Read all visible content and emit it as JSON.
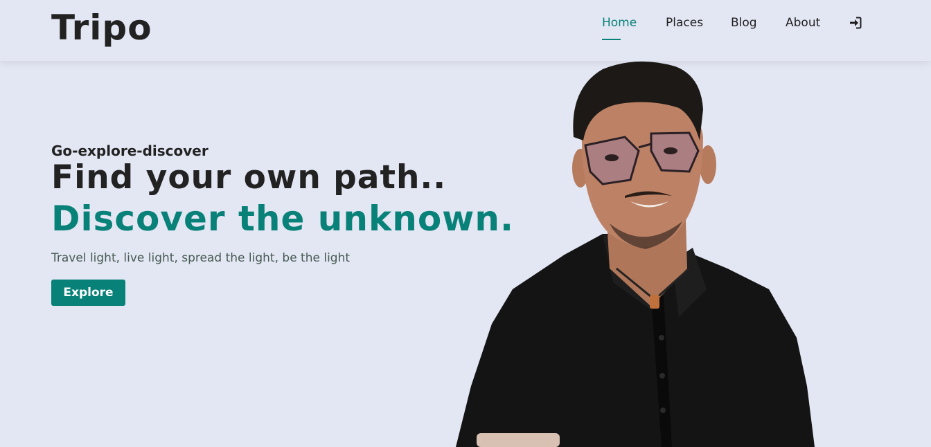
{
  "header": {
    "logo": "Tripo",
    "nav": [
      {
        "label": "Home",
        "active": true
      },
      {
        "label": "Places",
        "active": false
      },
      {
        "label": "Blog",
        "active": false
      },
      {
        "label": "About",
        "active": false
      }
    ],
    "login_icon": "sign-in-icon"
  },
  "hero": {
    "tagline": "Go-explore-discover",
    "headline1": "Find your own path..",
    "headline2": "Discover the unknown.",
    "subtext": "Travel light, live light, spread the light, be the light",
    "button_label": "Explore",
    "image": "person-portrait"
  },
  "colors": {
    "accent": "#088178",
    "background": "#e3e6f3",
    "text_dark": "#222222"
  }
}
